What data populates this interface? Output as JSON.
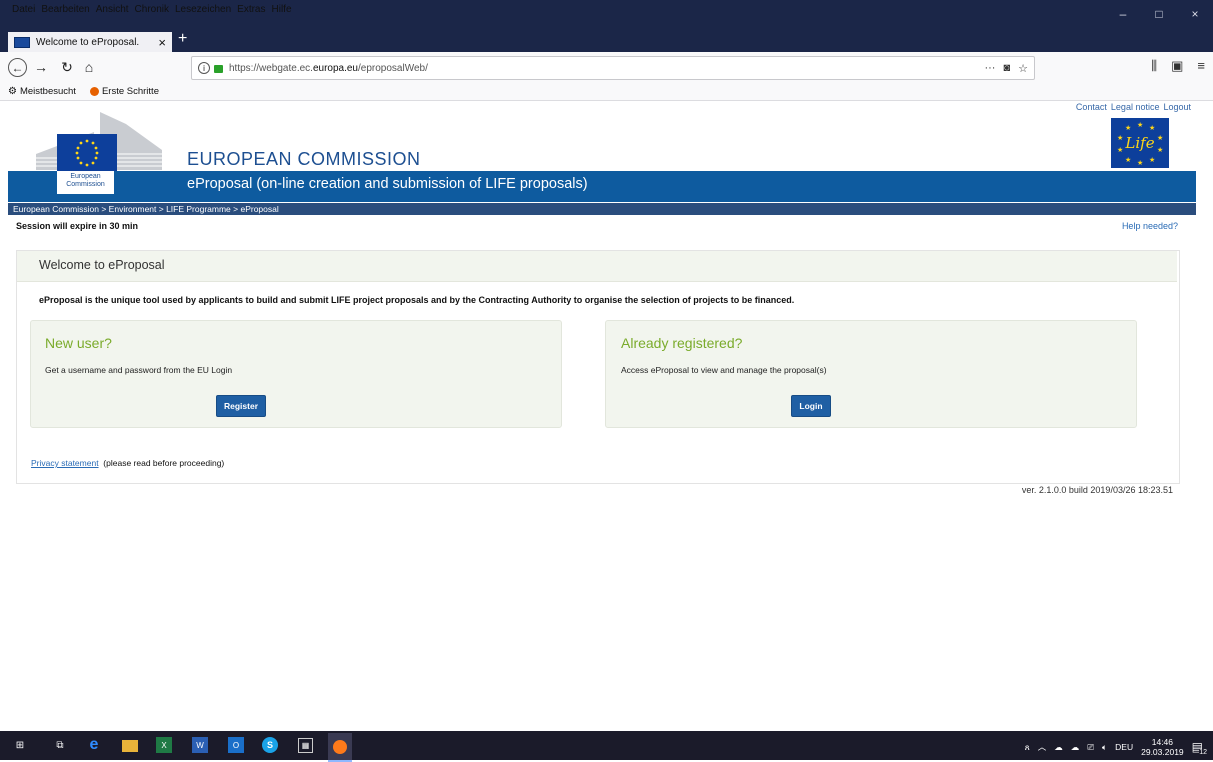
{
  "browser": {
    "menu": [
      "Datei",
      "Bearbeiten",
      "Ansicht",
      "Chronik",
      "Lesezeichen",
      "Extras",
      "Hilfe"
    ],
    "window_controls": {
      "minimize": "–",
      "maximize": "□",
      "close": "×"
    },
    "tab": {
      "title": "Welcome to eProposal.",
      "close": "×"
    },
    "new_tab": "+",
    "url": {
      "prefix": "https://webgate.ec.",
      "domain": "europa.eu",
      "path": "/eproposalWeb/"
    },
    "url_actions": {
      "more": "···",
      "pocket": "◙",
      "bookmark": "☆"
    },
    "bookmarks": [
      "Meistbesucht",
      "Erste Schritte"
    ]
  },
  "header": {
    "top_links": [
      "Contact",
      "Legal notice",
      "Logout"
    ],
    "org_name": "EUROPEAN COMMISSION",
    "logo_label_line1": "European",
    "logo_label_line2": "Commission",
    "subtitle": "eProposal (on-line creation and submission of LIFE proposals)",
    "life_logo_text": "Life"
  },
  "breadcrumb": "European Commission > Environment > LIFE Programme > eProposal",
  "session_text": "Session will expire in 30 min",
  "help_link": "Help needed?",
  "panel": {
    "title": "Welcome to eProposal",
    "intro": "eProposal is the unique tool used by applicants to build and submit LIFE project proposals and by the Contracting Authority to organise the selection of projects to be financed.",
    "new_user": {
      "title": "New user?",
      "text": "Get a username and password from the EU Login",
      "button": "Register"
    },
    "registered": {
      "title": "Already registered?",
      "text": "Access eProposal to view and manage the proposal(s)",
      "button": "Login"
    },
    "privacy_link": "Privacy statement",
    "privacy_note": "(please read before proceeding)"
  },
  "version": "ver. 2.1.0.0 build 2019/03/26 18:23.51",
  "taskbar": {
    "lang": "DEU",
    "time": "14:46",
    "date": "29.03.2019",
    "notifications": "12"
  },
  "colors": {
    "ec_blue": "#0e5b9f",
    "breadcrumb_bg": "#2a4d7d",
    "card_title_green": "#7aab2b",
    "button_blue": "#1f5fa4",
    "card_bg": "#f2f5ee"
  }
}
